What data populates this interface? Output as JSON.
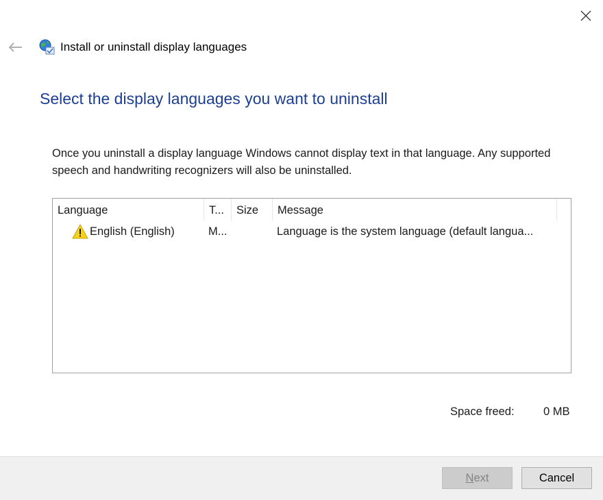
{
  "window": {
    "title": "Install or uninstall display languages",
    "close_icon": "close-icon",
    "back_icon": "back-arrow-icon",
    "app_icon": "globe-language-icon"
  },
  "main": {
    "heading": "Select the display languages you want to uninstall",
    "description": "Once you uninstall a display language Windows cannot display text in that language. Any supported speech and handwriting recognizers will also be uninstalled."
  },
  "list": {
    "columns": [
      "Language",
      "T...",
      "Size",
      "Message"
    ],
    "rows": [
      {
        "icon": "warning-icon",
        "language": "English (English)",
        "type": "M...",
        "size": "",
        "message": "Language is the system language (default langua..."
      }
    ]
  },
  "summary": {
    "space_freed_label": "Space freed:",
    "space_freed_value": "0 MB"
  },
  "buttons": {
    "next_first": "N",
    "next_rest": "ext",
    "cancel": "Cancel"
  },
  "colors": {
    "heading": "#1c3f94",
    "footer_bg": "#f0f0f0",
    "warning": "#f6d21d"
  }
}
